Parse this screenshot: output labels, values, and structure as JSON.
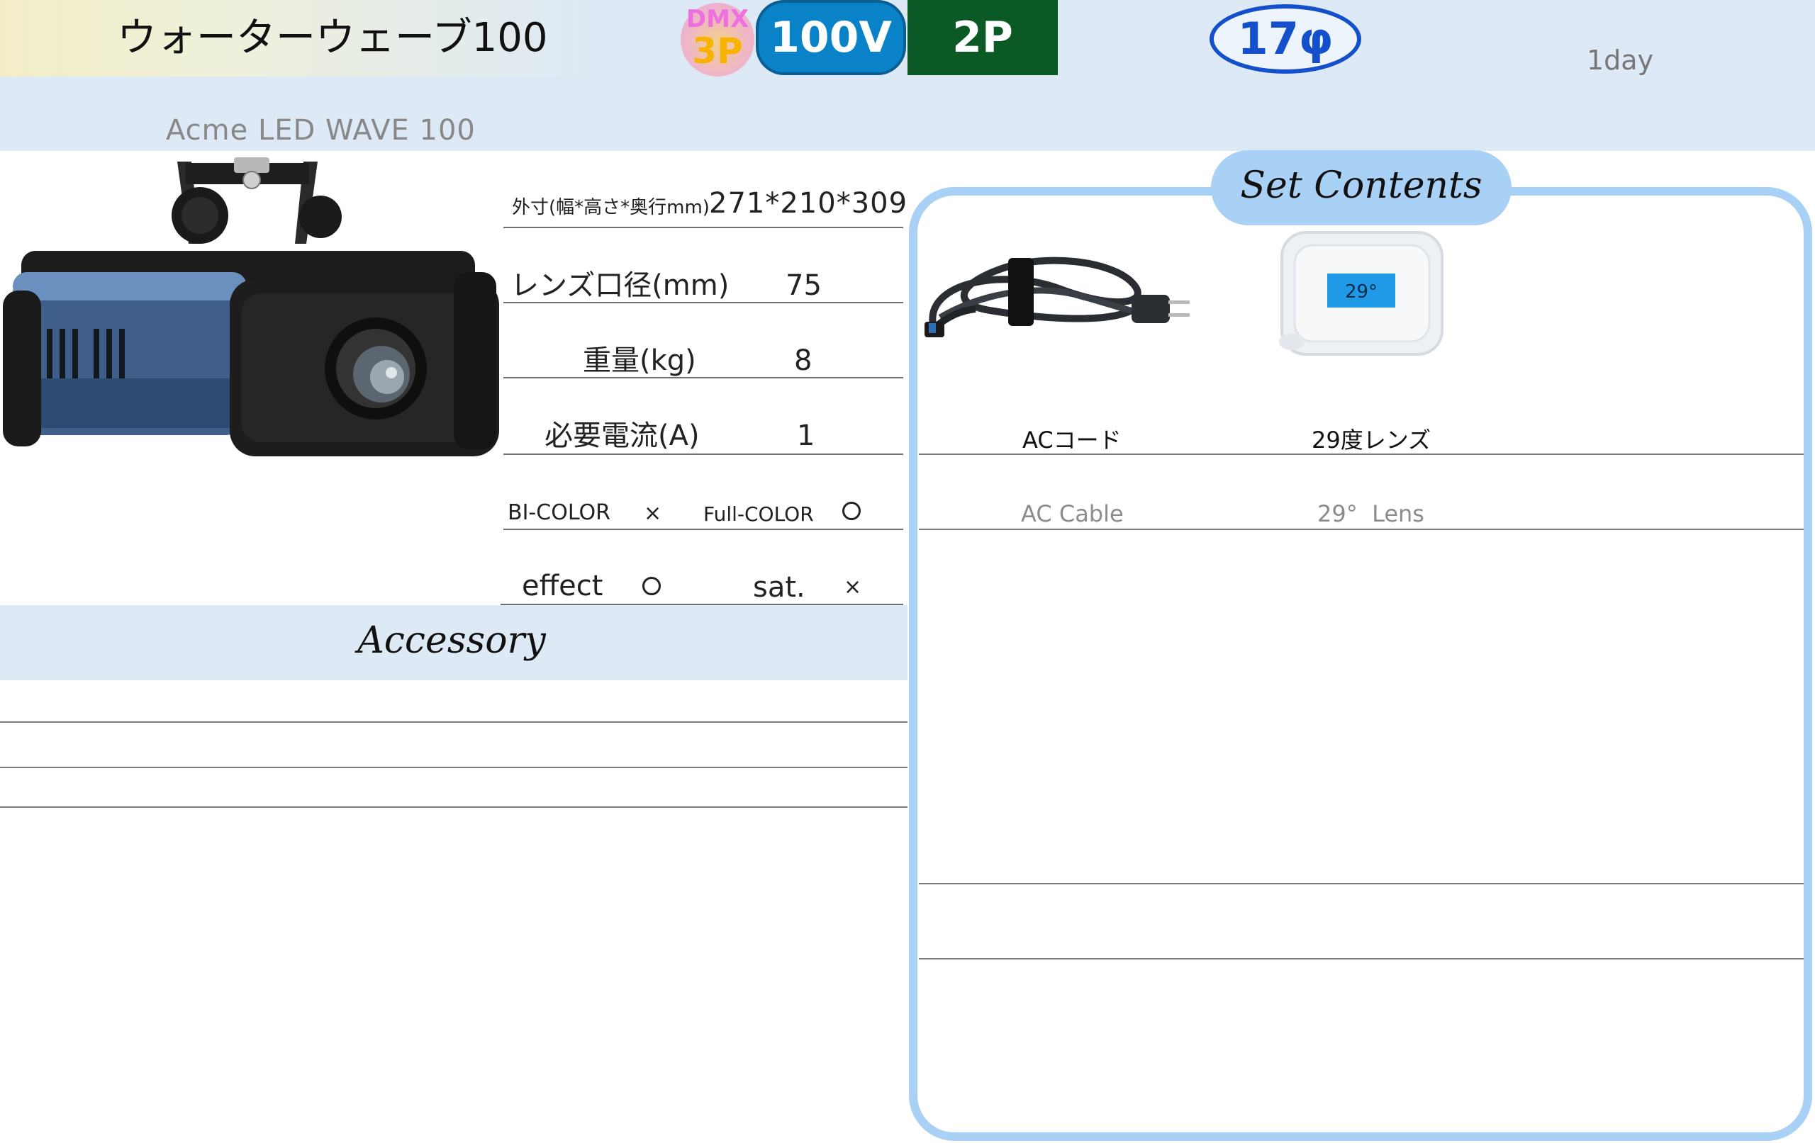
{
  "header": {
    "title": "ウォーターウェーブ100",
    "subtitle": "Acme LED WAVE 100",
    "rental_period": "1day",
    "badges": {
      "dmx_label": "DMX",
      "dmx_pin": "3P",
      "voltage": "100V",
      "plug": "2P",
      "diameter": "17φ"
    }
  },
  "specs": {
    "dimensions_label": "外寸(幅*高さ*奥行mm)",
    "dimensions_value": "271*210*309",
    "lens_label": "レンズ口径(mm)",
    "lens_value": "75",
    "weight_label": "重量(kg)",
    "weight_value": "8",
    "current_label": "必要電流(A)",
    "current_value": "1",
    "bicolor_label": "BI-COLOR",
    "bicolor_value": "×",
    "fullcolor_label": "Full-COLOR",
    "fullcolor_value": "○",
    "effect_label": "effect",
    "effect_value": "○",
    "sat_label": "sat.",
    "sat_value": "×"
  },
  "accessory": {
    "title": "Accessory"
  },
  "set_contents": {
    "title": "Set Contents",
    "items": [
      {
        "name_jp": "ACコード",
        "name_en": "AC Cable",
        "icon": "ac-cable-photo"
      },
      {
        "name_jp": "29度レンズ",
        "name_en": "29°  Lens",
        "icon": "lens-case-photo",
        "tag": "29°"
      }
    ]
  },
  "colors": {
    "band": "#dde9f5",
    "panel_border": "#a9d0f5",
    "voltage_badge": "#0a82c8",
    "plug_badge": "#0b5a26",
    "diameter_badge": "#1450cc"
  }
}
